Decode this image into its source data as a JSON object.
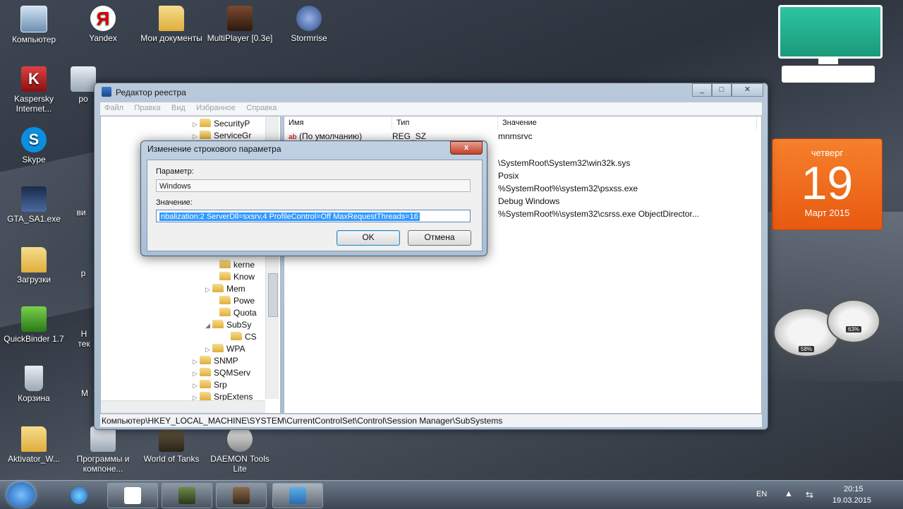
{
  "desktop": {
    "icons": [
      {
        "label": "Компьютер"
      },
      {
        "label": "Yandex"
      },
      {
        "label": "Мои документы"
      },
      {
        "label": "MultiPlayer [0.3e]"
      },
      {
        "label": "Stormrise"
      },
      {
        "label": "Kaspersky Internet..."
      },
      {
        "label": "Skype"
      },
      {
        "label": "GTA_SA1.exe"
      },
      {
        "label": "Загрузки"
      },
      {
        "label": "QuickBinder 1.7"
      },
      {
        "label": "Корзина"
      },
      {
        "label": "Aktivator_W..."
      },
      {
        "label": "Программы и компоне..."
      },
      {
        "label": "World of Tanks"
      },
      {
        "label": "DAEMON Tools Lite"
      }
    ],
    "partial_labels": [
      "ро",
      "ви",
      "р",
      "Н тек",
      "М"
    ]
  },
  "regedit": {
    "title": "Редактор реестра",
    "menu": [
      "Файл",
      "Правка",
      "Вид",
      "Избранное",
      "Справка"
    ],
    "tree": [
      {
        "label": "SecurityP"
      },
      {
        "label": "ServiceGr"
      },
      {
        "label": "kerne"
      },
      {
        "label": "Know"
      },
      {
        "label": "Mem"
      },
      {
        "label": "Powe"
      },
      {
        "label": "Quota"
      },
      {
        "label": "SubSy"
      },
      {
        "label": "CS"
      },
      {
        "label": "WPA"
      },
      {
        "label": "SNMP"
      },
      {
        "label": "SQMServ"
      },
      {
        "label": "Srp"
      },
      {
        "label": "SrpExtens"
      }
    ],
    "columns": [
      "Имя",
      "Тип",
      "Значение"
    ],
    "rows": [
      {
        "name": "(По умолчанию)",
        "type": "REG_SZ",
        "value": "mnmsrvc"
      },
      {
        "name": "",
        "type": "",
        "value": "\\SystemRoot\\System32\\win32k.sys"
      },
      {
        "name": "",
        "type": "",
        "value": "Posix"
      },
      {
        "name": "",
        "type": "",
        "value": "%SystemRoot%\\system32\\psxss.exe"
      },
      {
        "name": "",
        "type": "",
        "value": "Debug Windows"
      },
      {
        "name": "",
        "type": "",
        "value": "%SystemRoot%\\system32\\csrss.exe ObjectDirector..."
      }
    ],
    "status": "Компьютер\\HKEY_LOCAL_MACHINE\\SYSTEM\\CurrentControlSet\\Control\\Session Manager\\SubSystems"
  },
  "dialog": {
    "title": "Изменение строкового параметра",
    "param_label": "Параметр:",
    "param_value": "Windows",
    "value_label": "Значение:",
    "value_text": "nbalization:2 ServerDll=sxsrv,4 ProfileControl=Off MaxRequestThreads=16",
    "ok": "OK",
    "cancel": "Отмена",
    "close": "x"
  },
  "calendar": {
    "weekday": "четверг",
    "day": "19",
    "month_year": "Март 2015"
  },
  "gauges": {
    "cpu": "58%",
    "mem": "63%"
  },
  "taskbar": {
    "lang": "EN",
    "time": "20:15",
    "date": "19.03.2015"
  },
  "colors": {
    "selection": "#3399ff",
    "calendar": "#f06a1e",
    "monitor": "#22b48e"
  }
}
